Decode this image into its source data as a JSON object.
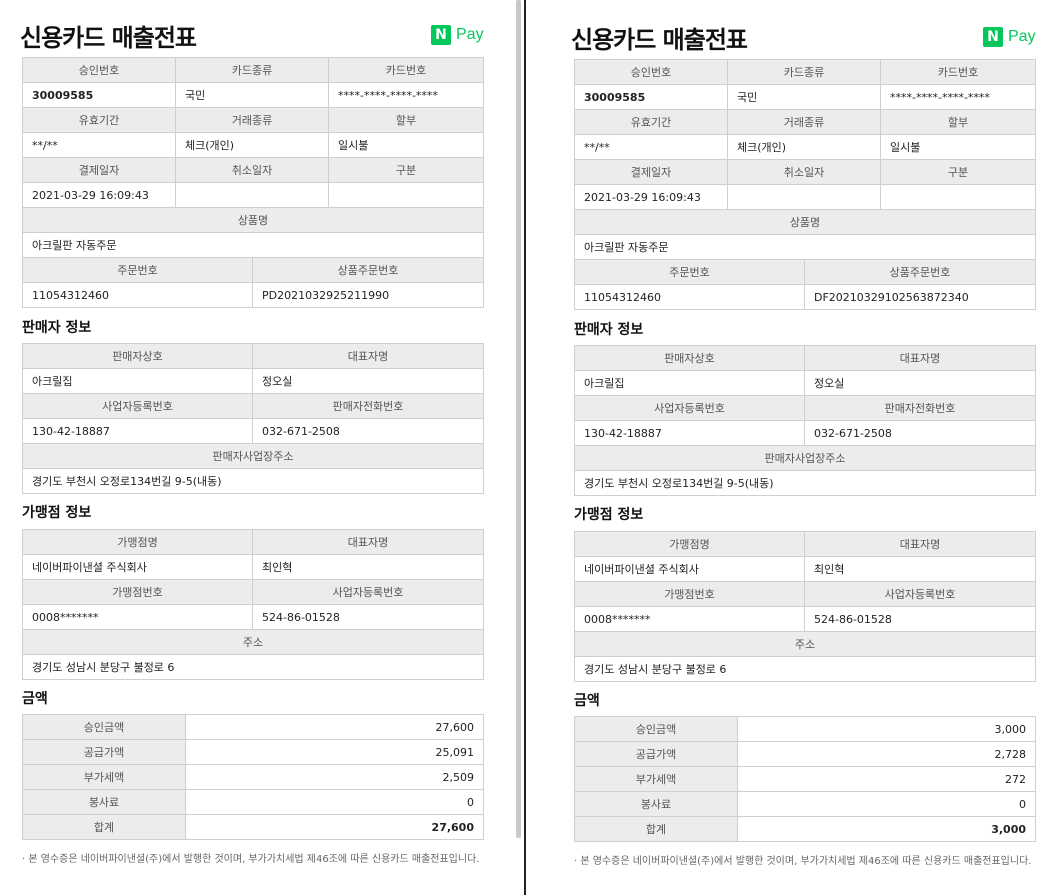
{
  "receipts": [
    {
      "title": "신용카드 매출전표",
      "logo": {
        "n": "N",
        "pay": "Pay"
      },
      "card": {
        "approval_no_label": "승인번호",
        "card_type_label": "카드종류",
        "card_no_label": "카드번호",
        "approval_no": "30009585",
        "card_type": "국민",
        "card_no": "****-****-****-****",
        "expiry_label": "유효기간",
        "tx_type_label": "거래종류",
        "installment_label": "할부",
        "expiry": "**/**",
        "tx_type": "체크(개인)",
        "installment": "일시불",
        "pay_date_label": "결제일자",
        "cancel_date_label": "취소일자",
        "division_label": "구분",
        "pay_date": "2021-03-29 16:09:43",
        "cancel_date": "",
        "division": "",
        "product_label": "상품명",
        "product": "아크릴판 자동주문",
        "order_no_label": "주문번호",
        "product_order_no_label": "상품주문번호",
        "order_no": "11054312460",
        "product_order_no": "PD2021032925211990"
      },
      "seller": {
        "section": "판매자 정보",
        "name_label": "판매자상호",
        "ceo_label": "대표자명",
        "name": "아크릴집",
        "ceo": "정오실",
        "biz_no_label": "사업자등록번호",
        "phone_label": "판매자전화번호",
        "biz_no": "130-42-18887",
        "phone": "032-671-2508",
        "address_label": "판매자사업장주소",
        "address": "경기도 부천시 오정로134번길 9-5(내동)"
      },
      "merchant": {
        "section": "가맹점 정보",
        "name_label": "가맹점명",
        "ceo_label": "대표자명",
        "name": "네이버파이낸셜 주식회사",
        "ceo": "최인혁",
        "no_label": "가맹점번호",
        "biz_no_label": "사업자등록번호",
        "no": "0008*******",
        "biz_no": "524-86-01528",
        "address_label": "주소",
        "address": "경기도 성남시 분당구 불정로 6"
      },
      "amount": {
        "section": "금액",
        "rows": [
          {
            "label": "승인금액",
            "value": "27,600"
          },
          {
            "label": "공급가액",
            "value": "25,091"
          },
          {
            "label": "부가세액",
            "value": "2,509"
          },
          {
            "label": "봉사료",
            "value": "0"
          },
          {
            "label": "합계",
            "value": "27,600"
          }
        ]
      },
      "note": "· 본 영수증은 네이버파이낸셜(주)에서 발행한 것이며, 부가가치세법 제46조에 따른 신용카드 매출전표입니다."
    },
    {
      "title": "신용카드 매출전표",
      "logo": {
        "n": "N",
        "pay": "Pay"
      },
      "card": {
        "approval_no_label": "승인번호",
        "card_type_label": "카드종류",
        "card_no_label": "카드번호",
        "approval_no": "30009585",
        "card_type": "국민",
        "card_no": "****-****-****-****",
        "expiry_label": "유효기간",
        "tx_type_label": "거래종류",
        "installment_label": "할부",
        "expiry": "**/**",
        "tx_type": "체크(개인)",
        "installment": "일시불",
        "pay_date_label": "결제일자",
        "cancel_date_label": "취소일자",
        "division_label": "구분",
        "pay_date": "2021-03-29 16:09:43",
        "cancel_date": "",
        "division": "",
        "product_label": "상품명",
        "product": "아크릴판 자동주문",
        "order_no_label": "주문번호",
        "product_order_no_label": "상품주문번호",
        "order_no": "11054312460",
        "product_order_no": "DF20210329102563872340"
      },
      "seller": {
        "section": "판매자 정보",
        "name_label": "판매자상호",
        "ceo_label": "대표자명",
        "name": "아크릴집",
        "ceo": "정오실",
        "biz_no_label": "사업자등록번호",
        "phone_label": "판매자전화번호",
        "biz_no": "130-42-18887",
        "phone": "032-671-2508",
        "address_label": "판매자사업장주소",
        "address": "경기도 부천시 오정로134번길 9-5(내동)"
      },
      "merchant": {
        "section": "가맹점 정보",
        "name_label": "가맹점명",
        "ceo_label": "대표자명",
        "name": "네이버파이낸셜 주식회사",
        "ceo": "최인혁",
        "no_label": "가맹점번호",
        "biz_no_label": "사업자등록번호",
        "no": "0008*******",
        "biz_no": "524-86-01528",
        "address_label": "주소",
        "address": "경기도 성남시 분당구 불정로 6"
      },
      "amount": {
        "section": "금액",
        "rows": [
          {
            "label": "승인금액",
            "value": "3,000"
          },
          {
            "label": "공급가액",
            "value": "2,728"
          },
          {
            "label": "부가세액",
            "value": "272"
          },
          {
            "label": "봉사료",
            "value": "0"
          },
          {
            "label": "합계",
            "value": "3,000"
          }
        ]
      },
      "note": "· 본 영수증은 네이버파이낸셜(주)에서 발행한 것이며, 부가가치세법 제46조에 따른 신용카드 매출전표입니다."
    }
  ],
  "colors": {
    "brand_green": "#03c75a",
    "total_green": "#1bb520",
    "header_bg": "#ececec",
    "border": "#cfcfcf"
  }
}
